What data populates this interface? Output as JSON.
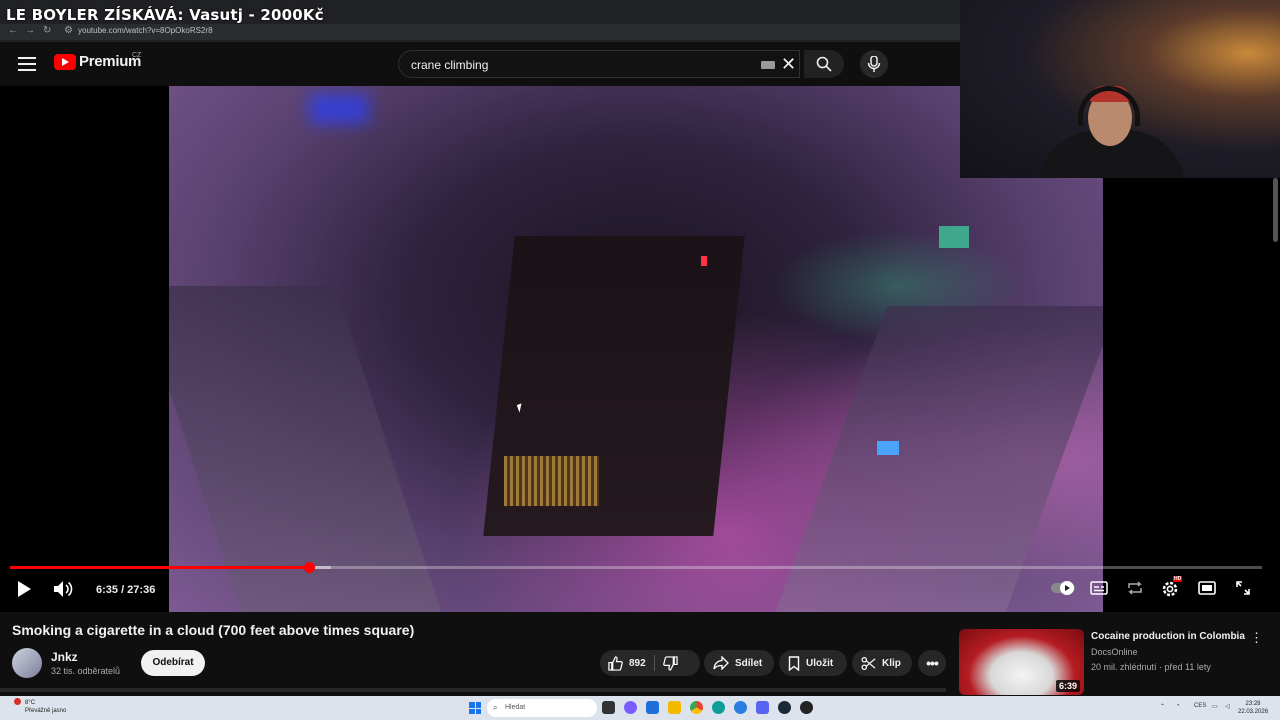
{
  "browser": {
    "stream_title": "LE BOYLER ZÍSKÁVÁ: Vasutj - 2000Kč",
    "url": "youtube.com/watch?v=8OpOkoRS2r8"
  },
  "header": {
    "logo_text": "Premium",
    "country": "CZ",
    "search_value": "crane climbing"
  },
  "player": {
    "time_display": "6:35 / 27:36",
    "progress_fraction": 0.2385,
    "buffer_fraction": 0.256,
    "settings_badge": "HD"
  },
  "video": {
    "title": "Smoking a cigarette in a cloud (700 feet above times square)",
    "channel_name": "Jnkz",
    "channel_subs": "32 tis. odběratelů",
    "subscribe_label": "Odebírat",
    "likes": "892",
    "share_label": "Sdílet",
    "save_label": "Uložit",
    "clip_label": "Klip"
  },
  "recommendation": {
    "title": "Cocaine production in Colombia",
    "channel": "DocsOnline",
    "meta": "20 mil. zhlédnutí · před 11 lety",
    "duration": "6:39"
  },
  "taskbar": {
    "weather_temp": "8°C",
    "weather_desc": "Převážně jasno",
    "search_placeholder": "Hledat",
    "lang": "CES",
    "time": "23:28",
    "date": "22.03.2026"
  }
}
